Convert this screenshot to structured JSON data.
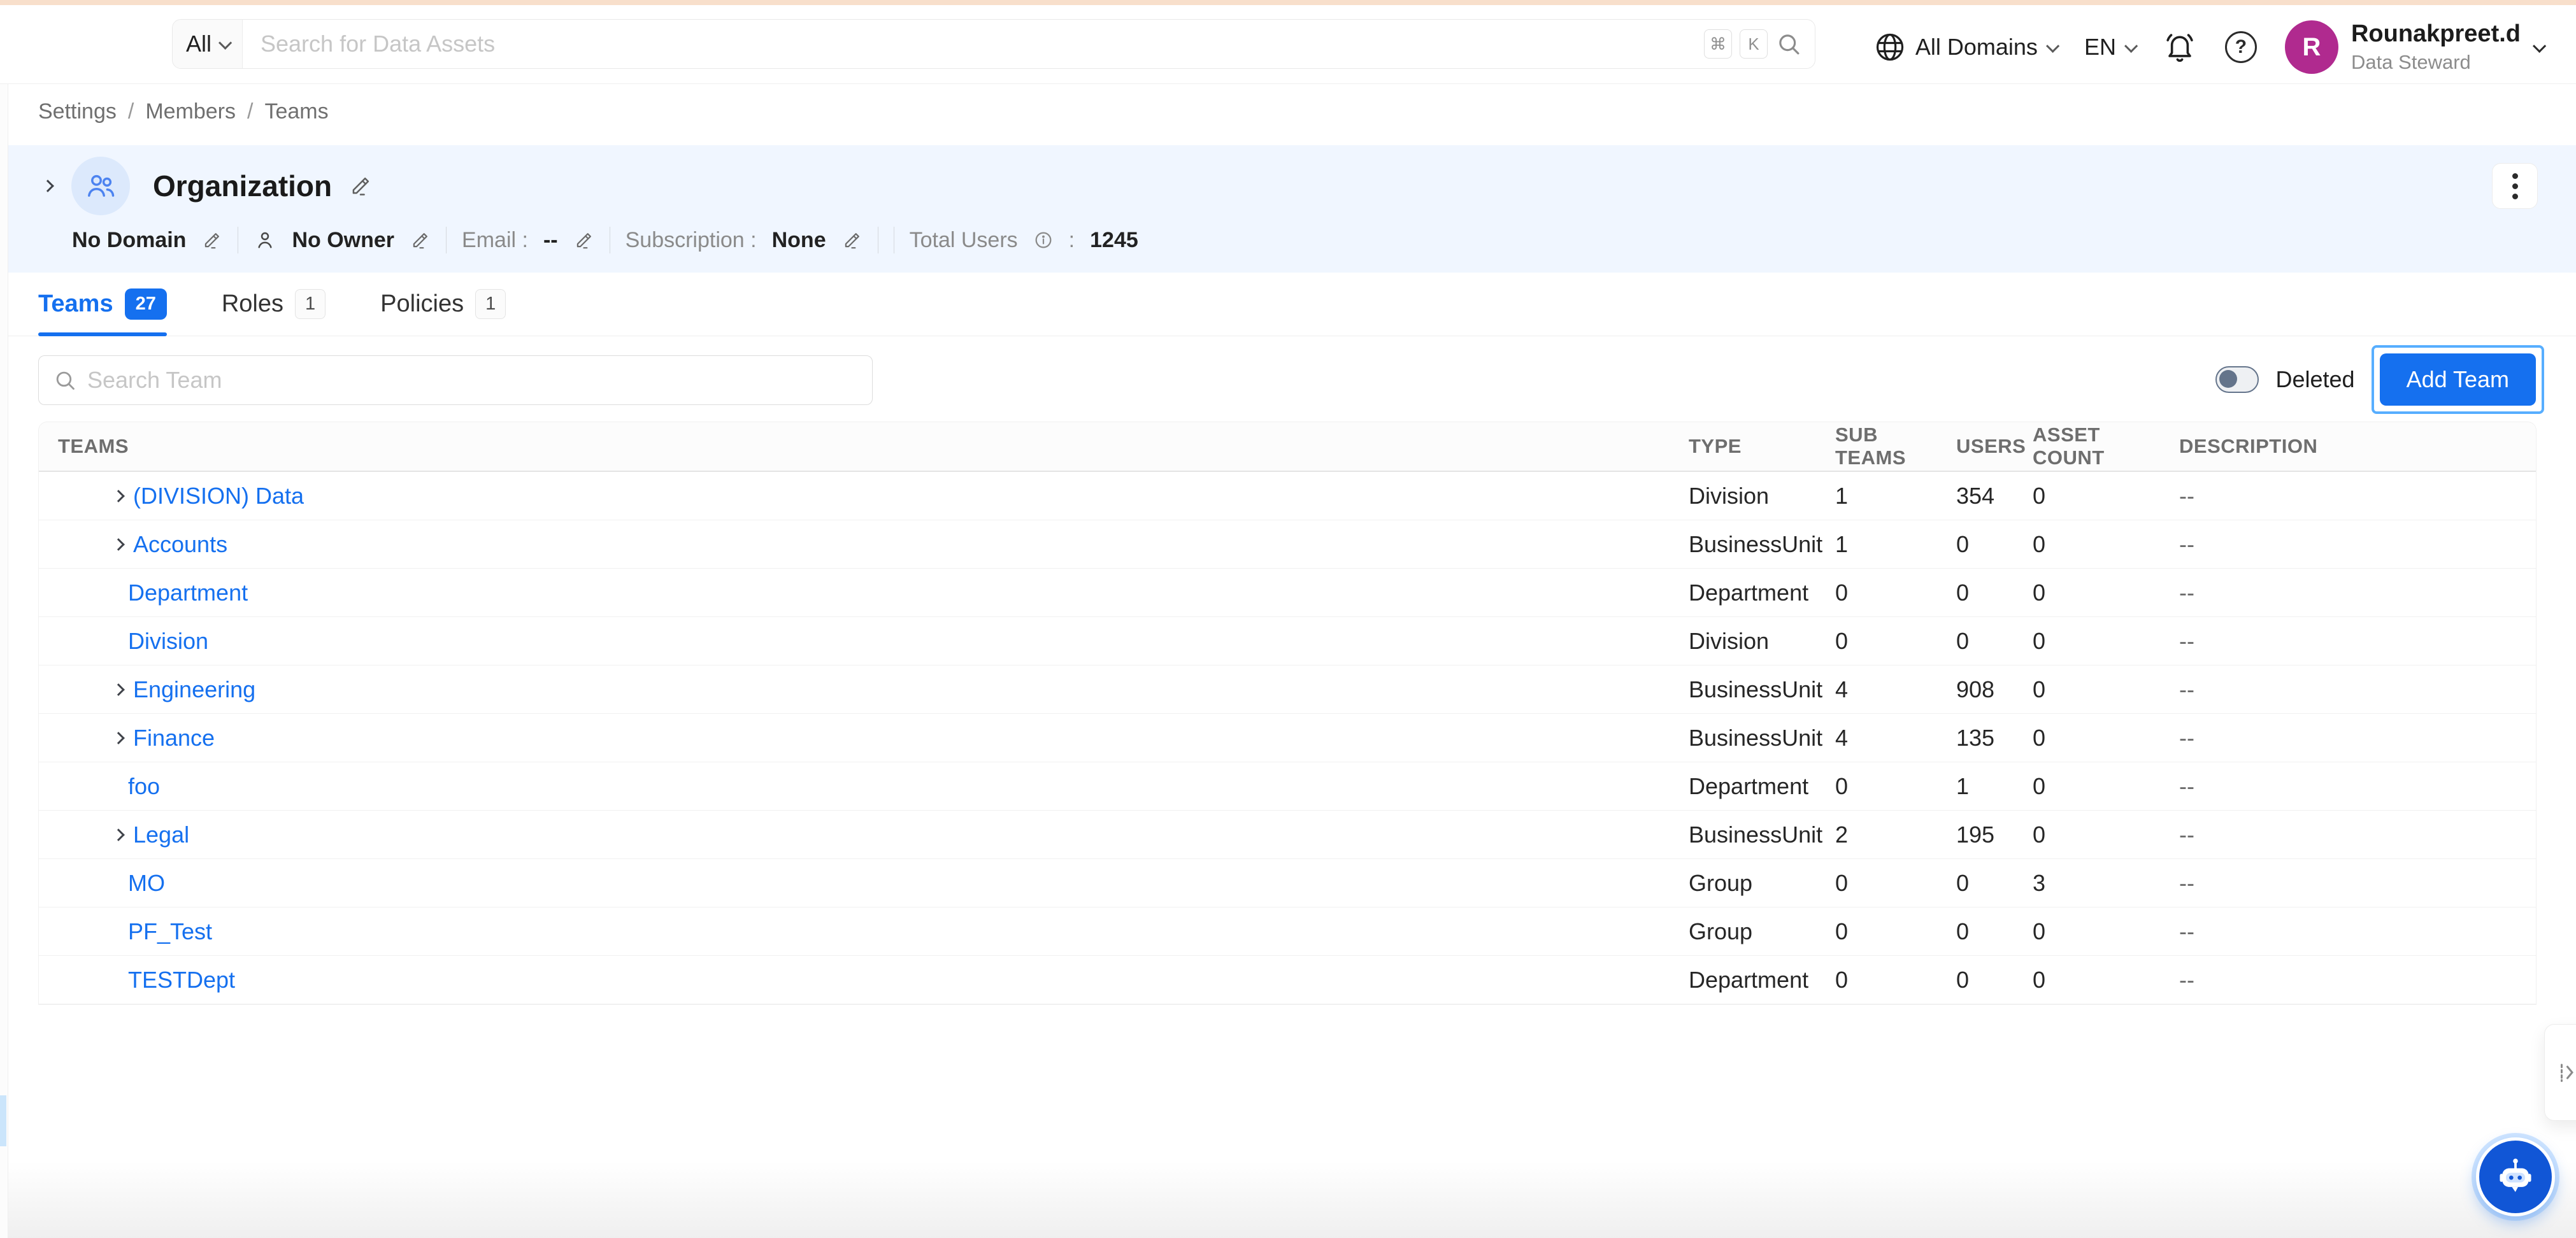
{
  "topbar": {
    "search_scope": "All",
    "search_placeholder": "Search for Data Assets",
    "shortcut_keys": [
      "⌘",
      "K"
    ],
    "domains_label": "All Domains",
    "language": "EN",
    "user": {
      "initial": "R",
      "name": "Rounakpreet.d",
      "role": "Data Steward"
    }
  },
  "breadcrumb": {
    "items": [
      "Settings",
      "Members",
      "Teams"
    ],
    "separator": "/"
  },
  "org": {
    "title": "Organization",
    "domain": "No Domain",
    "owner": "No Owner",
    "email_label": "Email :",
    "email_value": "--",
    "subscription_label": "Subscription :",
    "subscription_value": "None",
    "total_users_label": "Total Users",
    "total_users_colon": ":",
    "total_users_value": "1245"
  },
  "tabs": [
    {
      "label": "Teams",
      "count": "27",
      "active": true
    },
    {
      "label": "Roles",
      "count": "1",
      "active": false
    },
    {
      "label": "Policies",
      "count": "1",
      "active": false
    }
  ],
  "toolbar": {
    "search_placeholder": "Search Team",
    "deleted_label": "Deleted",
    "add_team_label": "Add Team"
  },
  "table": {
    "headers": [
      "TEAMS",
      "TYPE",
      "SUB TEAMS",
      "USERS",
      "ASSET COUNT",
      "DESCRIPTION"
    ],
    "rows": [
      {
        "name": "(DIVISION) Data",
        "expandable": true,
        "type": "Division",
        "sub_teams": "1",
        "users": "354",
        "asset_count": "0",
        "description": "--"
      },
      {
        "name": "Accounts",
        "expandable": true,
        "type": "BusinessUnit",
        "sub_teams": "1",
        "users": "0",
        "asset_count": "0",
        "description": "--"
      },
      {
        "name": "Department",
        "expandable": false,
        "type": "Department",
        "sub_teams": "0",
        "users": "0",
        "asset_count": "0",
        "description": "--"
      },
      {
        "name": "Division",
        "expandable": false,
        "type": "Division",
        "sub_teams": "0",
        "users": "0",
        "asset_count": "0",
        "description": "--"
      },
      {
        "name": "Engineering",
        "expandable": true,
        "type": "BusinessUnit",
        "sub_teams": "4",
        "users": "908",
        "asset_count": "0",
        "description": "--"
      },
      {
        "name": "Finance",
        "expandable": true,
        "type": "BusinessUnit",
        "sub_teams": "4",
        "users": "135",
        "asset_count": "0",
        "description": "--"
      },
      {
        "name": "foo",
        "expandable": false,
        "type": "Department",
        "sub_teams": "0",
        "users": "1",
        "asset_count": "0",
        "description": "--"
      },
      {
        "name": "Legal",
        "expandable": true,
        "type": "BusinessUnit",
        "sub_teams": "2",
        "users": "195",
        "asset_count": "0",
        "description": "--"
      },
      {
        "name": "MO",
        "expandable": false,
        "type": "Group",
        "sub_teams": "0",
        "users": "0",
        "asset_count": "3",
        "description": "--"
      },
      {
        "name": "PF_Test",
        "expandable": false,
        "type": "Group",
        "sub_teams": "0",
        "users": "0",
        "asset_count": "0",
        "description": "--"
      },
      {
        "name": "TESTDept",
        "expandable": false,
        "type": "Department",
        "sub_teams": "0",
        "users": "0",
        "asset_count": "0",
        "description": "--"
      }
    ]
  },
  "icons": {
    "globe": "globe-meridians",
    "bell": "notification-bell-outline",
    "help": "question-circle",
    "search": "magnifier",
    "org_avatar": "two-people-outline",
    "edit": "pencil",
    "owner": "person-outline",
    "info": "info-circle",
    "kebab": "vertical-three-dots",
    "chat": "robot-face",
    "expand": "chevron-right"
  },
  "colors": {
    "primary_blue": "#1570EF",
    "link_blue": "#1570EF",
    "avatar_magenta": "#B02A8F",
    "top_strip_peach": "#F8DFCB",
    "panel_light_blue": "#F0F6FF",
    "org_avatar_bg": "#DCE9FC",
    "focus_ring_blue": "#57AEFF",
    "toggle_gray": "#64748B",
    "chat_fab_blue": "#1156D6"
  }
}
